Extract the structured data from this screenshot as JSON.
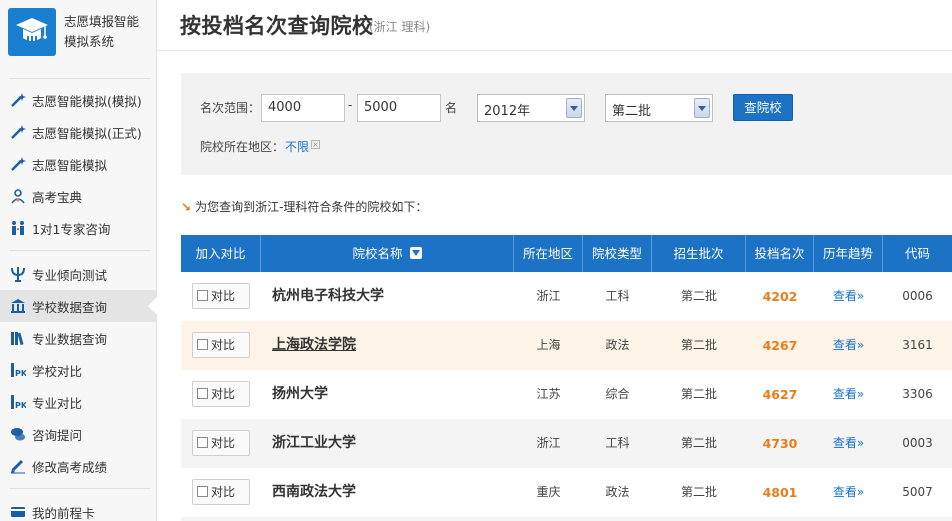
{
  "app": {
    "title_line1": "志愿填报智能",
    "title_line2": "模拟系统"
  },
  "sidebar": {
    "items": [
      {
        "label": "志愿智能模拟(模拟)",
        "icon": "magic-wand-icon"
      },
      {
        "label": "志愿智能模拟(正式)",
        "icon": "magic-wand-icon"
      },
      {
        "label": "志愿智能模拟",
        "icon": "magic-wand-icon"
      },
      {
        "label": "高考宝典",
        "icon": "user-group-icon"
      },
      {
        "label": "1对1专家咨询",
        "icon": "consult-people-icon"
      },
      {
        "label": "专业倾向测试",
        "icon": "psi-icon"
      },
      {
        "label": "学校数据查询",
        "icon": "bank-building-icon",
        "active": true
      },
      {
        "label": "专业数据查询",
        "icon": "books-icon"
      },
      {
        "label": "学校对比",
        "icon": "pk-icon"
      },
      {
        "label": "专业对比",
        "icon": "pk-icon"
      },
      {
        "label": "咨询提问",
        "icon": "chat-bubbles-icon"
      },
      {
        "label": "修改高考成绩",
        "icon": "edit-pencil-icon"
      },
      {
        "label": "我的前程卡",
        "icon": "card-icon"
      }
    ]
  },
  "header": {
    "title": "按投档名次查询院校",
    "subtitle": "(浙江 理科)"
  },
  "filter": {
    "range_label": "名次范围：",
    "from_value": "4000",
    "dash": "-",
    "to_value": "5000",
    "unit": "名",
    "year": "2012年",
    "batch": "第二批",
    "search_label": "查院校",
    "region_label": "院校所在地区：",
    "region_value": "不限",
    "region_clear": "×"
  },
  "result_note": "为您查询到浙江-理科符合条件的院校如下：",
  "table": {
    "headers": [
      "加入对比",
      "院校名称",
      "所在地区",
      "院校类型",
      "招生批次",
      "投档名次",
      "历年趋势",
      "代码"
    ],
    "compare_label": "对比",
    "view_label": "查看»",
    "rows": [
      {
        "name": "杭州电子科技大学",
        "region": "浙江",
        "type": "工科",
        "batch": "第二批",
        "rank": "4202",
        "code": "0006"
      },
      {
        "name": "上海政法学院",
        "region": "上海",
        "type": "政法",
        "batch": "第二批",
        "rank": "4267",
        "code": "3161"
      },
      {
        "name": "扬州大学",
        "region": "江苏",
        "type": "综合",
        "batch": "第二批",
        "rank": "4627",
        "code": "3306"
      },
      {
        "name": "浙江工业大学",
        "region": "浙江",
        "type": "工科",
        "batch": "第二批",
        "rank": "4730",
        "code": "0003"
      },
      {
        "name": "西南政法大学",
        "region": "重庆",
        "type": "政法",
        "batch": "第二批",
        "rank": "4801",
        "code": "5007"
      }
    ]
  },
  "colors": {
    "primary": "#1c73c6",
    "accent": "#e87d1a",
    "link": "#1a73c8"
  }
}
